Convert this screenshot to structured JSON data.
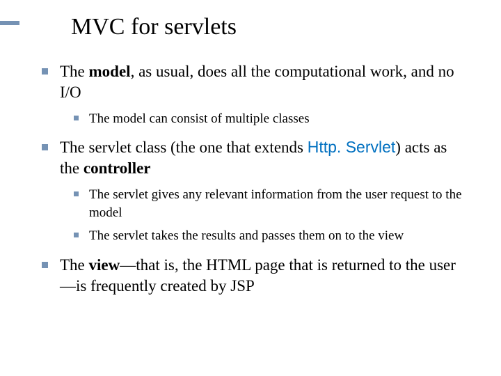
{
  "title": "MVC for servlets",
  "b1": {
    "pre": "The ",
    "bold": "model",
    "post": ", as usual, does all the computational work, and no I/O",
    "sub1": "The model can consist of multiple classes"
  },
  "b2": {
    "pre": "The servlet class (the one that extends ",
    "code": "Http. Servlet",
    "mid": ") acts as the ",
    "bold": "controller",
    "sub1": "The servlet gives any relevant information from the user request to the model",
    "sub2": "The servlet takes the results and passes them on to the view"
  },
  "b3": {
    "pre": "The ",
    "bold": "view",
    "post": "—that is, the HTML page that is returned to the user—is frequently created by JSP"
  }
}
